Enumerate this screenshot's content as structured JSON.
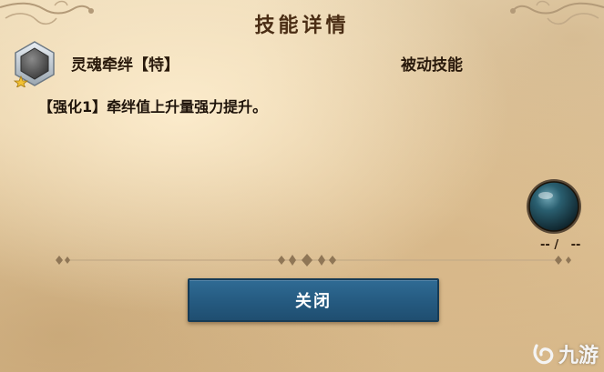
{
  "dialog": {
    "title": "技能详情"
  },
  "skill": {
    "icon": "hexagon-skill-icon",
    "name": "灵魂牵绊【特】",
    "type": "被动技能",
    "description": "【强化1】牵绊值上升量强力提升。"
  },
  "orb": {
    "icon": "dark-orb-icon",
    "value_text": "-- /   --"
  },
  "actions": {
    "close_label": "关闭"
  },
  "watermark": {
    "icon": "jiuyou-logo-icon",
    "text": "九游"
  },
  "colors": {
    "parchment": "#e3c99e",
    "title_text": "#4a2d14",
    "button": "#255a80",
    "orb": "#1d4b5a"
  }
}
